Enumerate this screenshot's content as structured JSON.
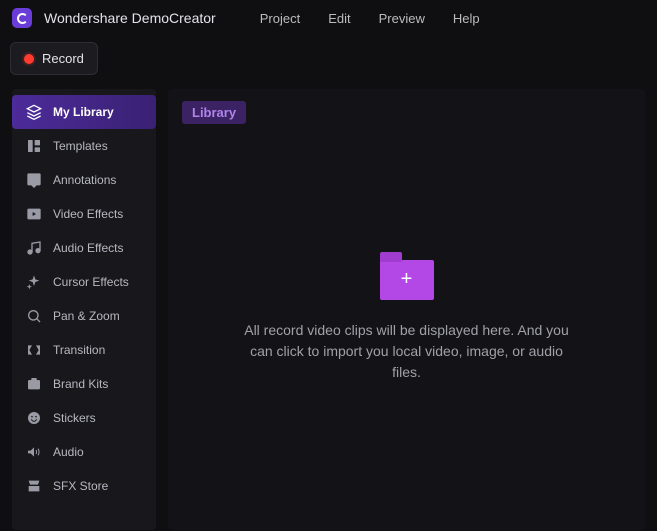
{
  "app": {
    "title": "Wondershare DemoCreator"
  },
  "menu": {
    "project": "Project",
    "edit": "Edit",
    "preview": "Preview",
    "help": "Help"
  },
  "record": {
    "label": "Record"
  },
  "sidebar": {
    "items": [
      {
        "label": "My Library"
      },
      {
        "label": "Templates"
      },
      {
        "label": "Annotations"
      },
      {
        "label": "Video Effects"
      },
      {
        "label": "Audio Effects"
      },
      {
        "label": "Cursor Effects"
      },
      {
        "label": "Pan & Zoom"
      },
      {
        "label": "Transition"
      },
      {
        "label": "Brand Kits"
      },
      {
        "label": "Stickers"
      },
      {
        "label": "Audio"
      },
      {
        "label": "SFX Store"
      }
    ]
  },
  "main": {
    "tab": "Library",
    "empty_text": "All record video clips will be displayed here. And you can click to import you local video, image, or audio files."
  }
}
